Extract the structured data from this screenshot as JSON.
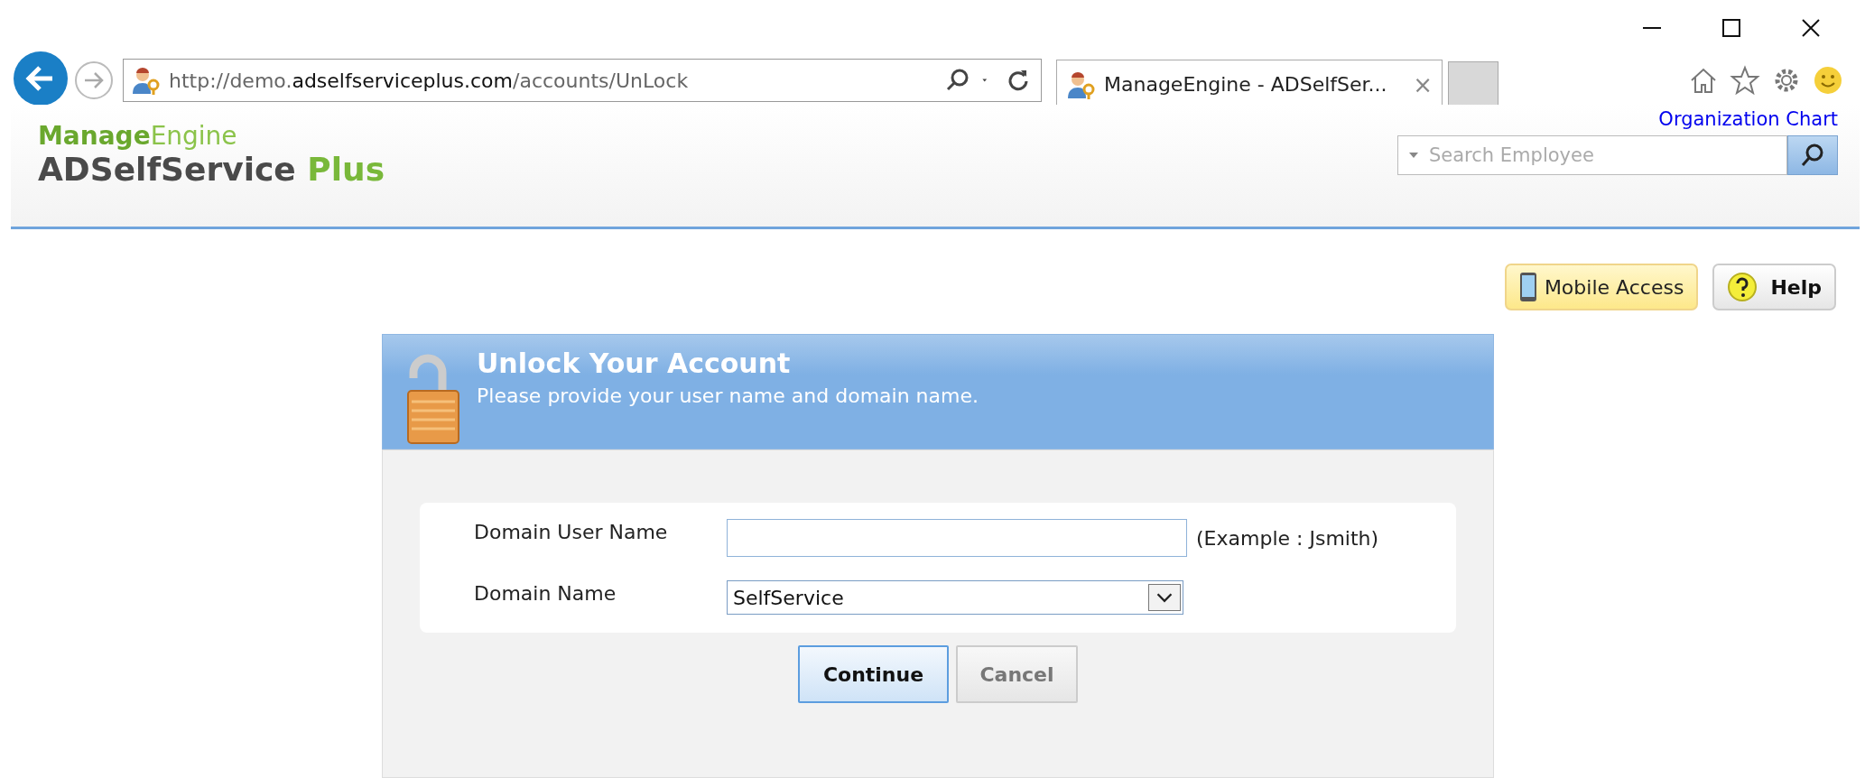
{
  "browser": {
    "url_prefix": "http://demo.",
    "url_domain": "adselfserviceplus.com",
    "url_path": "/accounts/UnLock",
    "tab_title": "ManageEngine - ADSelfSer...",
    "tab_close": "×"
  },
  "header": {
    "brand_top_bold": "Manage",
    "brand_top_rest": "Engine",
    "brand_main": "ADSelfService",
    "brand_plus": "Plus",
    "org_chart_link": "Organization Chart",
    "search": {
      "placeholder": "Search Employee"
    }
  },
  "toolbar_buttons": [
    {
      "kind": "mobile",
      "label": "Mobile Access"
    },
    {
      "kind": "help",
      "label": "Help"
    }
  ],
  "dialog": {
    "title": "Unlock Your Account",
    "subtitle": "Please provide your user name and domain name.",
    "fields": [
      {
        "kind": "text",
        "label": "Domain User Name",
        "hint": "(Example : Jsmith)"
      },
      {
        "kind": "select",
        "label": "Domain Name",
        "value": "SelfService"
      }
    ],
    "buttons": [
      {
        "label": "Continue",
        "selected": true
      },
      {
        "label": "Cancel",
        "selected": false
      }
    ]
  }
}
